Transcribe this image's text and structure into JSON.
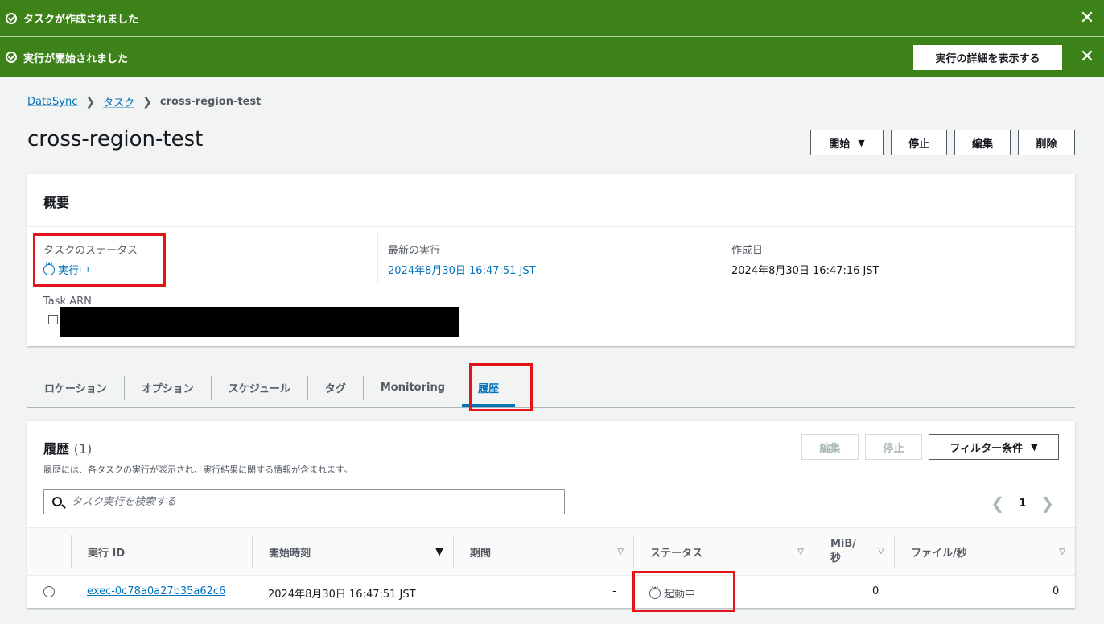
{
  "flash": [
    {
      "message": "タスクが作成されました"
    },
    {
      "message": "実行が開始されました",
      "action_label": "実行の詳細を表示する"
    }
  ],
  "breadcrumb": {
    "root": "DataSync",
    "tasks": "タスク",
    "current": "cross-region-test"
  },
  "page": {
    "title": "cross-region-test"
  },
  "header_actions": {
    "start": "開始",
    "stop": "停止",
    "edit": "編集",
    "delete": "削除"
  },
  "summary": {
    "heading": "概要",
    "task_status_label": "タスクのステータス",
    "task_status_value": "実行中",
    "latest_exec_label": "最新の実行",
    "latest_exec_value": "2024年8月30日 16:47:51 JST",
    "created_label": "作成日",
    "created_value": "2024年8月30日 16:47:16 JST",
    "arn_label": "Task ARN"
  },
  "tabs": [
    "ロケーション",
    "オプション",
    "スケジュール",
    "タグ",
    "Monitoring",
    "履歴"
  ],
  "history": {
    "heading": "履歴",
    "count": "(1)",
    "description": "履歴には、各タスクの実行が表示され、実行結果に関する情報が含まれます。",
    "edit": "編集",
    "stop": "停止",
    "filter": "フィルター条件",
    "search_placeholder": "タスク実行を検索する",
    "page": "1",
    "columns": [
      "実行 ID",
      "開始時刻",
      "期間",
      "ステータス",
      "MiB/\n秒",
      "ファイル/秒"
    ],
    "rows": [
      {
        "id": "exec-0c78a0a27b35a62c6",
        "start": "2024年8月30日 16:47:51 JST",
        "duration": "-",
        "status": "起動中",
        "mib": "0",
        "files": "0"
      }
    ]
  },
  "colors": {
    "success": "#3d8219",
    "link": "#0073bb",
    "highlight": "#e3151a"
  }
}
